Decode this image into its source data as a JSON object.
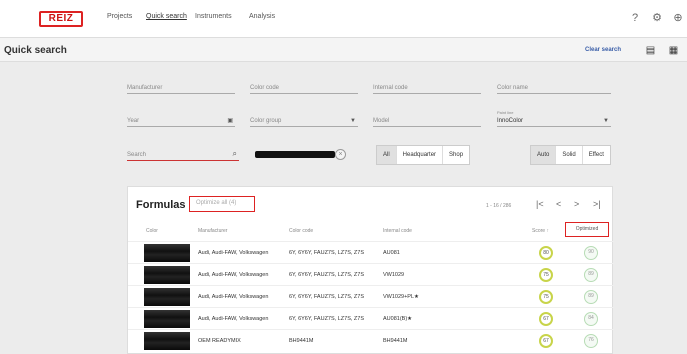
{
  "topbar": {
    "logo": "REIZ",
    "nav": [
      "Projects",
      "Quick search",
      "Instruments",
      "Analysis"
    ],
    "active_nav": "Quick search",
    "icons": [
      "help-icon",
      "settings-icon",
      "globe-icon"
    ]
  },
  "subbar": {
    "title": "Quick search",
    "clear_label": "Clear search",
    "view_icons": [
      "list-view-icon",
      "grid-view-icon"
    ]
  },
  "filters": {
    "manufacturer": "Manufacturer",
    "color_code": "Color code",
    "internal_code": "Internal code",
    "color_name": "Color name",
    "year": "Year",
    "color_group": "Color group",
    "model": "Model",
    "paint_line_label": "Paint line",
    "paint_line_value": "InnoColor",
    "search": "Search"
  },
  "scope": {
    "options": [
      "All",
      "Headquarter",
      "Shop"
    ]
  },
  "paint_type": {
    "options": [
      "Auto",
      "Solid",
      "Effect"
    ],
    "selected": "Auto"
  },
  "formulas": {
    "title": "Formulas",
    "optimize_all": "Optimize all (4)",
    "pagination": "1 - 16 / 286",
    "pag_first": "|<",
    "pag_prev": "<",
    "pag_next": ">",
    "pag_last": ">|",
    "columns": {
      "color": "Color",
      "manufacturer": "Manufacturer",
      "color_code": "Color code",
      "internal_code": "Internal code",
      "score": "Score ↑",
      "optimized": "Optimized"
    },
    "rows": [
      {
        "manufacturer": "Audi, Audi-FAW, Volkswagen",
        "color_code": "6Y, 6Y6Y, FAUZ7S, LZ7S, Z7S",
        "internal_code": "AU081",
        "score": "80",
        "optimized": "90"
      },
      {
        "manufacturer": "Audi, Audi-FAW, Volkswagen",
        "color_code": "6Y, 6Y6Y, FAUZ7S, LZ7S, Z7S",
        "internal_code": "VW1029",
        "score": "75",
        "optimized": "89"
      },
      {
        "manufacturer": "Audi, Audi-FAW, Volkswagen",
        "color_code": "6Y, 6Y6Y, FAUZ7S, LZ7S, Z7S",
        "internal_code": "VW1029+PL★",
        "score": "75",
        "optimized": "89"
      },
      {
        "manufacturer": "Audi, Audi-FAW, Volkswagen",
        "color_code": "6Y, 6Y6Y, FAUZ7S, LZ7S, Z7S",
        "internal_code": "AU081(B)★",
        "score": "67",
        "optimized": "84"
      },
      {
        "manufacturer": "OEM READYMIX",
        "color_code": "BH9441M",
        "internal_code": "BH9441M",
        "score": "67",
        "optimized": "76"
      }
    ]
  },
  "colors": {
    "accent": "#3a5ea8",
    "highlight": "#d22222",
    "score_ring": "#c8d44a",
    "optimized_ring": "#b7dcb5"
  }
}
